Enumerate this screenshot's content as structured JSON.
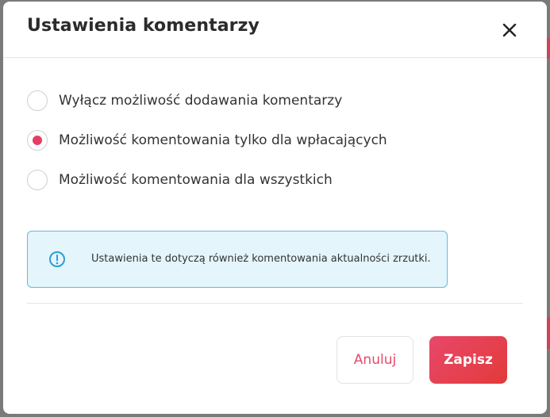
{
  "dialog": {
    "title": "Ustawienia komentarzy",
    "options": [
      {
        "label": "Wyłącz możliwość dodawania komentarzy",
        "selected": false
      },
      {
        "label": "Możliwość komentowania tylko dla wpłacających",
        "selected": true
      },
      {
        "label": "Możliwość komentowania dla wszystkich",
        "selected": false
      }
    ],
    "info": {
      "icon": "info-circle-icon",
      "text": "Ustawienia te dotyczą również komentowania aktualności zrzutki."
    },
    "buttons": {
      "cancel": "Anuluj",
      "save": "Zapisz"
    }
  },
  "colors": {
    "accent": "#e63e63",
    "info_border": "#68b9db",
    "info_background": "#e4f5fb",
    "info_icon": "#2a9fd6"
  }
}
